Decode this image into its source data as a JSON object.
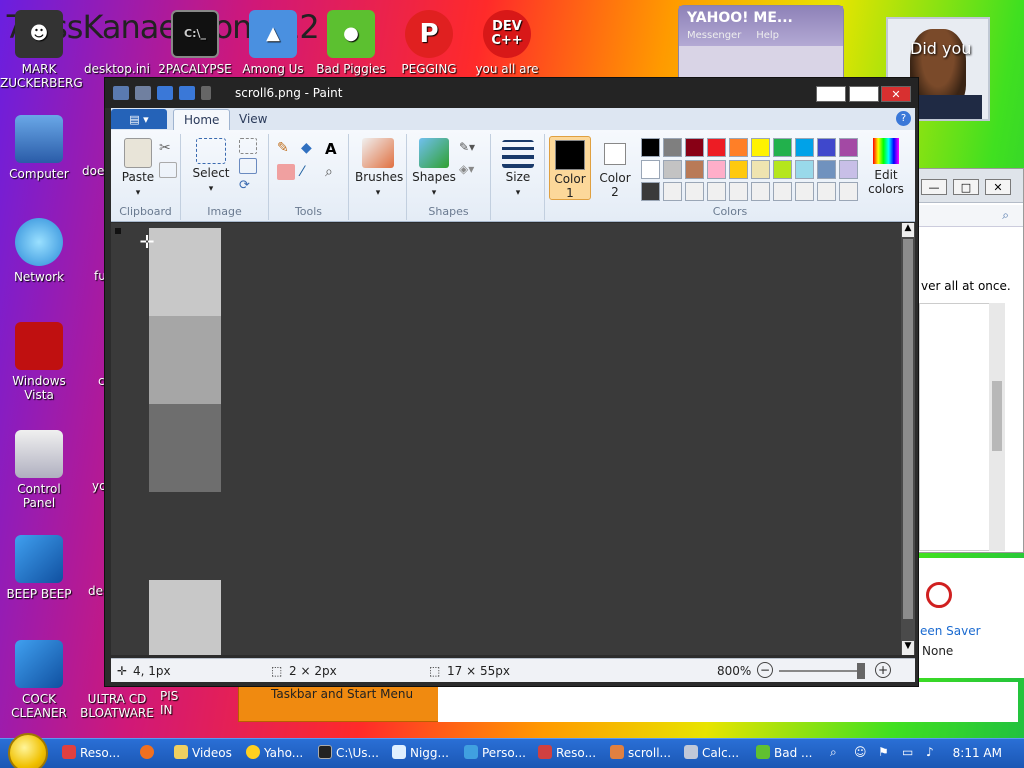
{
  "desktop": {
    "banner": "7 ossKanae ition 012",
    "icons": [
      {
        "label": "MARK ZUCKERBERG"
      },
      {
        "label": "desktop.ini"
      },
      {
        "label": "2PACALYPSE"
      },
      {
        "label": "Among Us"
      },
      {
        "label": "Bad Piggies"
      },
      {
        "label": "PEGGING"
      },
      {
        "label": "you all are"
      },
      {
        "label": "Computer"
      },
      {
        "label": "Network"
      },
      {
        "label": "Windows Vista"
      },
      {
        "label": "Control Panel"
      },
      {
        "label": "BEEP BEEP"
      },
      {
        "label": "COCK CLEANER"
      },
      {
        "label": "ULTRA CD BLOATWARE"
      }
    ],
    "partial_labels": [
      "doe",
      "fu",
      "c",
      "yo",
      "de",
      "PIS IN"
    ],
    "dev_icon_text": "DEV C++"
  },
  "yahoo": {
    "title": "YAHOO! ME...",
    "subtitle": "Messenger",
    "menu2": "Help"
  },
  "obama_text": "Did you",
  "right_window": {
    "text": "ver all at once.",
    "screensaver_label": "een Saver",
    "screensaver_value": "None"
  },
  "orange_bar": {
    "label": "Taskbar and Start Menu"
  },
  "paint": {
    "title": "scroll6.png - Paint",
    "tabs": {
      "home": "Home",
      "view": "View"
    },
    "groups": {
      "clipboard": "Clipboard",
      "image": "Image",
      "tools": "Tools",
      "shapes": "Shapes",
      "colors": "Colors"
    },
    "buttons": {
      "paste": "Paste",
      "select": "Select",
      "brushes": "Brushes",
      "shapes": "Shapes",
      "size": "Size",
      "color1": "Color 1",
      "color2": "Color 2",
      "edit_colors": "Edit colors"
    },
    "palette_row1": [
      "#000000",
      "#7f7f7f",
      "#880015",
      "#ed1c24",
      "#ff7f27",
      "#fff200",
      "#22b14c",
      "#00a2e8",
      "#3f48cc",
      "#a349a4"
    ],
    "palette_row2": [
      "#ffffff",
      "#c3c3c3",
      "#b97a57",
      "#ffaec9",
      "#ffc90e",
      "#efe4b0",
      "#b5e61d",
      "#99d9ea",
      "#7092be",
      "#c8bfe7"
    ],
    "status": {
      "cursor": "4, 1px",
      "selection": "2 × 2px",
      "size": "17 × 55px",
      "zoom": "800%"
    }
  },
  "taskbar": {
    "items": [
      "Reso...",
      "Videos",
      "Yaho...",
      "C:\\Us...",
      "Nigg...",
      "Perso...",
      "Reso...",
      "scroll...",
      "Calc...",
      "Bad ..."
    ],
    "time": "8:11 AM"
  }
}
